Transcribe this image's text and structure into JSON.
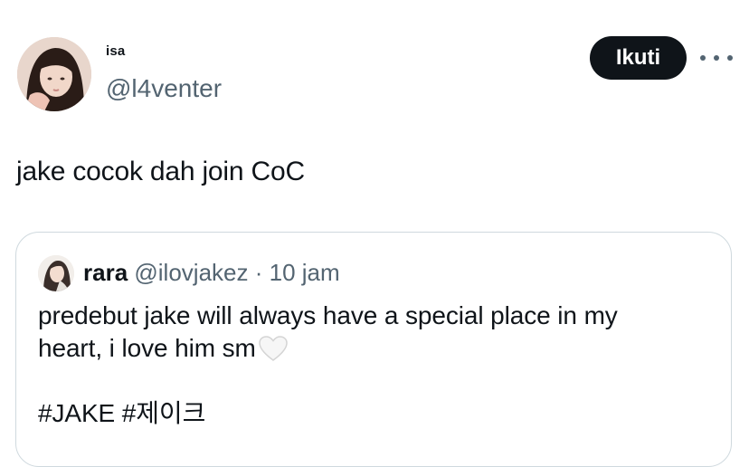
{
  "tweet": {
    "author": {
      "display_name": "isa",
      "handle": "@l4venter",
      "avatar_icon": "user-avatar-photo"
    },
    "follow_label": "Ikuti",
    "more_icon": "more-dots-icon",
    "text": "jake cocok dah join CoC"
  },
  "quote": {
    "author": {
      "display_name": "rara",
      "handle": "@ilovjakez",
      "avatar_icon": "quoted-user-avatar-photo"
    },
    "separator": "·",
    "time": "10 jam",
    "line1": "predebut jake will always have a special place in my",
    "line2": "heart, i love him sm",
    "emoji_icon": "white-heart-icon",
    "hashtags": "#JAKE #제이크"
  },
  "colors": {
    "text_primary": "#0f1419",
    "text_secondary": "#536471",
    "border": "#cfd9de",
    "button_bg": "#0f1419"
  }
}
